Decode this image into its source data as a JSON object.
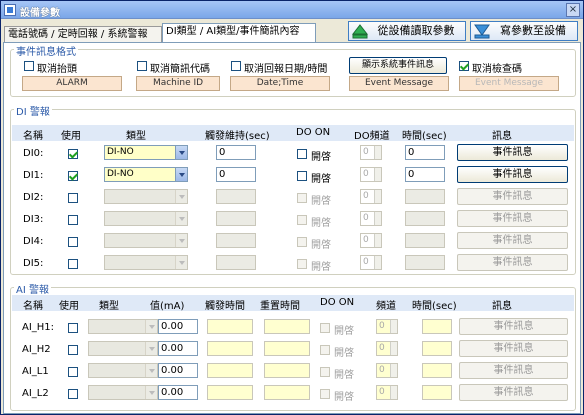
{
  "window": {
    "title": "設備參數",
    "close": "×"
  },
  "tabs": [
    {
      "label": "電話號碼 / 定時回報 / 系統警報"
    },
    {
      "label": "DI類型 / AI類型/事件簡訊內容"
    }
  ],
  "actions": {
    "read": "從設備讀取參數",
    "write": "寫參數至設備"
  },
  "event_format": {
    "title": "事件訊息格式",
    "options": [
      {
        "label": "取消抬頭",
        "value": "ALARM",
        "checked": false
      },
      {
        "label": "取消簡訊代碼",
        "value": "Machine ID",
        "checked": false
      },
      {
        "label": "取消回報日期/時間",
        "value": "Date;Time",
        "checked": false
      },
      {
        "label": "顯示系統事件訊息",
        "value": "Event Message",
        "is_button": true
      },
      {
        "label": "取消檢查碼",
        "value": "Event Message",
        "checked": true
      }
    ]
  },
  "di": {
    "title": "DI 警報",
    "headers": {
      "name": "名稱",
      "use": "使用",
      "type": "類型",
      "trigger": "觸發維持(sec)",
      "do_on": "DO ON",
      "do_channel": "DO頻道",
      "time": "時間(sec)",
      "message": "訊息"
    },
    "rows": [
      {
        "name": "DI0:",
        "use": true,
        "type": "DI-NO",
        "trigger": "0",
        "do_label": "開啓",
        "do_channel": "0",
        "time": "0",
        "message": "事件訊息",
        "enabled": true
      },
      {
        "name": "DI1:",
        "use": true,
        "type": "DI-NO",
        "trigger": "0",
        "do_label": "開啓",
        "do_channel": "0",
        "time": "0",
        "message": "事件訊息",
        "enabled": true
      },
      {
        "name": "DI2:",
        "use": false,
        "type": "",
        "trigger": "",
        "do_label": "開啓",
        "do_channel": "0",
        "time": "",
        "message": "事件訊息",
        "enabled": false
      },
      {
        "name": "DI3:",
        "use": false,
        "type": "",
        "trigger": "",
        "do_label": "開啓",
        "do_channel": "0",
        "time": "",
        "message": "事件訊息",
        "enabled": false
      },
      {
        "name": "DI4:",
        "use": false,
        "type": "",
        "trigger": "",
        "do_label": "開啓",
        "do_channel": "0",
        "time": "",
        "message": "事件訊息",
        "enabled": false
      },
      {
        "name": "DI5:",
        "use": false,
        "type": "",
        "trigger": "",
        "do_label": "開啓",
        "do_channel": "0",
        "time": "",
        "message": "事件訊息",
        "enabled": false
      }
    ]
  },
  "ai": {
    "title": "AI 警報",
    "headers": {
      "name": "名稱",
      "use": "使用",
      "type": "類型",
      "value": "值(mA)",
      "trigger_time": "觸發時間",
      "reset_time": "重置時間",
      "do_on": "DO ON",
      "channel": "頻道",
      "time": "時間(sec)",
      "message": "訊息"
    },
    "rows": [
      {
        "name": "AI_H1:",
        "value": "0.00",
        "do_label": "開啓",
        "channel": "0",
        "message": "事件訊息"
      },
      {
        "name": "AI_H2",
        "value": "0.00",
        "do_label": "開啓",
        "channel": "0",
        "message": "事件訊息"
      },
      {
        "name": "AI_L1",
        "value": "0.00",
        "do_label": "開啓",
        "channel": "0",
        "message": "事件訊息"
      },
      {
        "name": "AI_L2",
        "value": "0.00",
        "do_label": "開啓",
        "channel": "0",
        "message": "事件訊息"
      }
    ]
  }
}
